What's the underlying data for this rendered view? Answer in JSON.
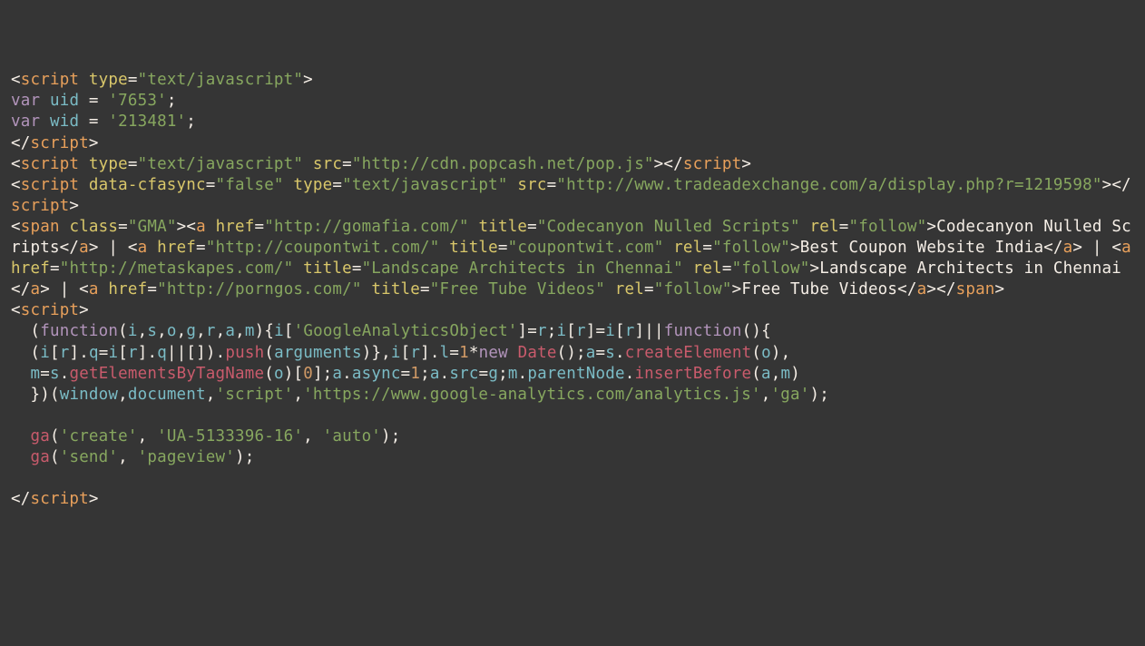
{
  "tokens": [
    {
      "c": "white",
      "t": "<"
    },
    {
      "c": "tag",
      "t": "script"
    },
    {
      "c": "white",
      "t": " "
    },
    {
      "c": "attr",
      "t": "type"
    },
    {
      "c": "white",
      "t": "="
    },
    {
      "c": "str",
      "t": "\"text/javascript\""
    },
    {
      "c": "white",
      "t": ">\n"
    },
    {
      "c": "kw",
      "t": "var"
    },
    {
      "c": "white",
      "t": " "
    },
    {
      "c": "cyan",
      "t": "uid"
    },
    {
      "c": "white",
      "t": " = "
    },
    {
      "c": "str",
      "t": "'7653'"
    },
    {
      "c": "white",
      "t": ";\n"
    },
    {
      "c": "kw",
      "t": "var"
    },
    {
      "c": "white",
      "t": " "
    },
    {
      "c": "cyan",
      "t": "wid"
    },
    {
      "c": "white",
      "t": " = "
    },
    {
      "c": "str",
      "t": "'213481'"
    },
    {
      "c": "white",
      "t": ";\n"
    },
    {
      "c": "white",
      "t": "</"
    },
    {
      "c": "tag",
      "t": "script"
    },
    {
      "c": "white",
      "t": ">\n"
    },
    {
      "c": "white",
      "t": "<"
    },
    {
      "c": "tag",
      "t": "script"
    },
    {
      "c": "white",
      "t": " "
    },
    {
      "c": "attr",
      "t": "type"
    },
    {
      "c": "white",
      "t": "="
    },
    {
      "c": "str",
      "t": "\"text/javascript\""
    },
    {
      "c": "white",
      "t": " "
    },
    {
      "c": "attr",
      "t": "src"
    },
    {
      "c": "white",
      "t": "="
    },
    {
      "c": "str",
      "t": "\"http://cdn.popcash.net/pop.js\""
    },
    {
      "c": "white",
      "t": "></"
    },
    {
      "c": "tag",
      "t": "script"
    },
    {
      "c": "white",
      "t": ">\n"
    },
    {
      "c": "white",
      "t": "<"
    },
    {
      "c": "tag",
      "t": "script"
    },
    {
      "c": "white",
      "t": " "
    },
    {
      "c": "attr",
      "t": "data-cfasync"
    },
    {
      "c": "white",
      "t": "="
    },
    {
      "c": "str",
      "t": "\"false\""
    },
    {
      "c": "white",
      "t": " "
    },
    {
      "c": "attr",
      "t": "type"
    },
    {
      "c": "white",
      "t": "="
    },
    {
      "c": "str",
      "t": "\"text/javascript\""
    },
    {
      "c": "white",
      "t": " "
    },
    {
      "c": "attr",
      "t": "src"
    },
    {
      "c": "white",
      "t": "="
    },
    {
      "c": "str",
      "t": "\"http://www.tradeadexchange.com/a/display.php?r=1219598\""
    },
    {
      "c": "white",
      "t": "></"
    },
    {
      "c": "tag",
      "t": "script"
    },
    {
      "c": "white",
      "t": ">\n"
    },
    {
      "c": "white",
      "t": "<"
    },
    {
      "c": "tag",
      "t": "span"
    },
    {
      "c": "white",
      "t": " "
    },
    {
      "c": "attr",
      "t": "class"
    },
    {
      "c": "white",
      "t": "="
    },
    {
      "c": "str",
      "t": "\"GMA\""
    },
    {
      "c": "white",
      "t": "><"
    },
    {
      "c": "tag",
      "t": "a"
    },
    {
      "c": "white",
      "t": " "
    },
    {
      "c": "attr",
      "t": "href"
    },
    {
      "c": "white",
      "t": "="
    },
    {
      "c": "str",
      "t": "\"http://gomafia.com/\""
    },
    {
      "c": "white",
      "t": " "
    },
    {
      "c": "attr",
      "t": "title"
    },
    {
      "c": "white",
      "t": "="
    },
    {
      "c": "str",
      "t": "\"Codecanyon Nulled Scripts\""
    },
    {
      "c": "white",
      "t": " "
    },
    {
      "c": "attr",
      "t": "rel"
    },
    {
      "c": "white",
      "t": "="
    },
    {
      "c": "str",
      "t": "\"follow\""
    },
    {
      "c": "white",
      "t": ">Codecanyon Nulled Scripts</"
    },
    {
      "c": "tag",
      "t": "a"
    },
    {
      "c": "white",
      "t": "> | <"
    },
    {
      "c": "tag",
      "t": "a"
    },
    {
      "c": "white",
      "t": " "
    },
    {
      "c": "attr",
      "t": "href"
    },
    {
      "c": "white",
      "t": "="
    },
    {
      "c": "str",
      "t": "\"http://coupontwit.com/\""
    },
    {
      "c": "white",
      "t": " "
    },
    {
      "c": "attr",
      "t": "title"
    },
    {
      "c": "white",
      "t": "="
    },
    {
      "c": "str",
      "t": "\"coupontwit.com\""
    },
    {
      "c": "white",
      "t": " "
    },
    {
      "c": "attr",
      "t": "rel"
    },
    {
      "c": "white",
      "t": "="
    },
    {
      "c": "str",
      "t": "\"follow\""
    },
    {
      "c": "white",
      "t": ">Best Coupon Website India</"
    },
    {
      "c": "tag",
      "t": "a"
    },
    {
      "c": "white",
      "t": "> | <"
    },
    {
      "c": "tag",
      "t": "a"
    },
    {
      "c": "white",
      "t": " "
    },
    {
      "c": "attr",
      "t": "href"
    },
    {
      "c": "white",
      "t": "="
    },
    {
      "c": "str",
      "t": "\"http://metaskapes.com/\""
    },
    {
      "c": "white",
      "t": " "
    },
    {
      "c": "attr",
      "t": "title"
    },
    {
      "c": "white",
      "t": "="
    },
    {
      "c": "str",
      "t": "\"Landscape Architects in Chennai\""
    },
    {
      "c": "white",
      "t": " "
    },
    {
      "c": "attr",
      "t": "rel"
    },
    {
      "c": "white",
      "t": "="
    },
    {
      "c": "str",
      "t": "\"follow\""
    },
    {
      "c": "white",
      "t": ">Landscape Architects in Chennai</"
    },
    {
      "c": "tag",
      "t": "a"
    },
    {
      "c": "white",
      "t": "> | <"
    },
    {
      "c": "tag",
      "t": "a"
    },
    {
      "c": "white",
      "t": " "
    },
    {
      "c": "attr",
      "t": "href"
    },
    {
      "c": "white",
      "t": "="
    },
    {
      "c": "str",
      "t": "\"http://porngos.com/\""
    },
    {
      "c": "white",
      "t": " "
    },
    {
      "c": "attr",
      "t": "title"
    },
    {
      "c": "white",
      "t": "="
    },
    {
      "c": "str",
      "t": "\"Free Tube Videos\""
    },
    {
      "c": "white",
      "t": " "
    },
    {
      "c": "attr",
      "t": "rel"
    },
    {
      "c": "white",
      "t": "="
    },
    {
      "c": "str",
      "t": "\"follow\""
    },
    {
      "c": "white",
      "t": ">Free Tube Videos</"
    },
    {
      "c": "tag",
      "t": "a"
    },
    {
      "c": "white",
      "t": "></"
    },
    {
      "c": "tag",
      "t": "span"
    },
    {
      "c": "white",
      "t": ">\n"
    },
    {
      "c": "white",
      "t": "<"
    },
    {
      "c": "tag",
      "t": "script"
    },
    {
      "c": "white",
      "t": ">\n"
    },
    {
      "c": "white",
      "t": "  ("
    },
    {
      "c": "kw",
      "t": "function"
    },
    {
      "c": "white",
      "t": "("
    },
    {
      "c": "cyan",
      "t": "i"
    },
    {
      "c": "white",
      "t": ","
    },
    {
      "c": "cyan",
      "t": "s"
    },
    {
      "c": "white",
      "t": ","
    },
    {
      "c": "cyan",
      "t": "o"
    },
    {
      "c": "white",
      "t": ","
    },
    {
      "c": "cyan",
      "t": "g"
    },
    {
      "c": "white",
      "t": ","
    },
    {
      "c": "cyan",
      "t": "r"
    },
    {
      "c": "white",
      "t": ","
    },
    {
      "c": "cyan",
      "t": "a"
    },
    {
      "c": "white",
      "t": ","
    },
    {
      "c": "cyan",
      "t": "m"
    },
    {
      "c": "white",
      "t": "){"
    },
    {
      "c": "cyan",
      "t": "i"
    },
    {
      "c": "white",
      "t": "["
    },
    {
      "c": "str",
      "t": "'GoogleAnalyticsObject'"
    },
    {
      "c": "white",
      "t": "]="
    },
    {
      "c": "cyan",
      "t": "r"
    },
    {
      "c": "white",
      "t": ";"
    },
    {
      "c": "cyan",
      "t": "i"
    },
    {
      "c": "white",
      "t": "["
    },
    {
      "c": "cyan",
      "t": "r"
    },
    {
      "c": "white",
      "t": "]="
    },
    {
      "c": "cyan",
      "t": "i"
    },
    {
      "c": "white",
      "t": "["
    },
    {
      "c": "cyan",
      "t": "r"
    },
    {
      "c": "white",
      "t": "]||"
    },
    {
      "c": "kw",
      "t": "function"
    },
    {
      "c": "white",
      "t": "(){\n"
    },
    {
      "c": "white",
      "t": "  ("
    },
    {
      "c": "cyan",
      "t": "i"
    },
    {
      "c": "white",
      "t": "["
    },
    {
      "c": "cyan",
      "t": "r"
    },
    {
      "c": "white",
      "t": "]."
    },
    {
      "c": "cyan",
      "t": "q"
    },
    {
      "c": "white",
      "t": "="
    },
    {
      "c": "cyan",
      "t": "i"
    },
    {
      "c": "white",
      "t": "["
    },
    {
      "c": "cyan",
      "t": "r"
    },
    {
      "c": "white",
      "t": "]."
    },
    {
      "c": "cyan",
      "t": "q"
    },
    {
      "c": "white",
      "t": "||[])."
    },
    {
      "c": "mag",
      "t": "push"
    },
    {
      "c": "white",
      "t": "("
    },
    {
      "c": "cyan",
      "t": "arguments"
    },
    {
      "c": "white",
      "t": ")},"
    },
    {
      "c": "cyan",
      "t": "i"
    },
    {
      "c": "white",
      "t": "["
    },
    {
      "c": "cyan",
      "t": "r"
    },
    {
      "c": "white",
      "t": "]."
    },
    {
      "c": "cyan",
      "t": "l"
    },
    {
      "c": "white",
      "t": "="
    },
    {
      "c": "num",
      "t": "1"
    },
    {
      "c": "white",
      "t": "*"
    },
    {
      "c": "kw",
      "t": "new"
    },
    {
      "c": "white",
      "t": " "
    },
    {
      "c": "mag",
      "t": "Date"
    },
    {
      "c": "white",
      "t": "();"
    },
    {
      "c": "cyan",
      "t": "a"
    },
    {
      "c": "white",
      "t": "="
    },
    {
      "c": "cyan",
      "t": "s"
    },
    {
      "c": "white",
      "t": "."
    },
    {
      "c": "mag",
      "t": "createElement"
    },
    {
      "c": "white",
      "t": "("
    },
    {
      "c": "cyan",
      "t": "o"
    },
    {
      "c": "white",
      "t": "),\n"
    },
    {
      "c": "white",
      "t": "  "
    },
    {
      "c": "cyan",
      "t": "m"
    },
    {
      "c": "white",
      "t": "="
    },
    {
      "c": "cyan",
      "t": "s"
    },
    {
      "c": "white",
      "t": "."
    },
    {
      "c": "mag",
      "t": "getElementsByTagName"
    },
    {
      "c": "white",
      "t": "("
    },
    {
      "c": "cyan",
      "t": "o"
    },
    {
      "c": "white",
      "t": ")["
    },
    {
      "c": "num",
      "t": "0"
    },
    {
      "c": "white",
      "t": "];"
    },
    {
      "c": "cyan",
      "t": "a"
    },
    {
      "c": "white",
      "t": "."
    },
    {
      "c": "cyan",
      "t": "async"
    },
    {
      "c": "white",
      "t": "="
    },
    {
      "c": "num",
      "t": "1"
    },
    {
      "c": "white",
      "t": ";"
    },
    {
      "c": "cyan",
      "t": "a"
    },
    {
      "c": "white",
      "t": "."
    },
    {
      "c": "cyan",
      "t": "src"
    },
    {
      "c": "white",
      "t": "="
    },
    {
      "c": "cyan",
      "t": "g"
    },
    {
      "c": "white",
      "t": ";"
    },
    {
      "c": "cyan",
      "t": "m"
    },
    {
      "c": "white",
      "t": "."
    },
    {
      "c": "cyan",
      "t": "parentNode"
    },
    {
      "c": "white",
      "t": "."
    },
    {
      "c": "mag",
      "t": "insertBefore"
    },
    {
      "c": "white",
      "t": "("
    },
    {
      "c": "cyan",
      "t": "a"
    },
    {
      "c": "white",
      "t": ","
    },
    {
      "c": "cyan",
      "t": "m"
    },
    {
      "c": "white",
      "t": ")\n"
    },
    {
      "c": "white",
      "t": "  })("
    },
    {
      "c": "cyan",
      "t": "window"
    },
    {
      "c": "white",
      "t": ","
    },
    {
      "c": "cyan",
      "t": "document"
    },
    {
      "c": "white",
      "t": ","
    },
    {
      "c": "str",
      "t": "'script'"
    },
    {
      "c": "white",
      "t": ","
    },
    {
      "c": "str",
      "t": "'https://www.google-analytics.com/analytics.js'"
    },
    {
      "c": "white",
      "t": ","
    },
    {
      "c": "str",
      "t": "'ga'"
    },
    {
      "c": "white",
      "t": ");\n"
    },
    {
      "c": "white",
      "t": "\n"
    },
    {
      "c": "white",
      "t": "  "
    },
    {
      "c": "mag",
      "t": "ga"
    },
    {
      "c": "white",
      "t": "("
    },
    {
      "c": "str",
      "t": "'create'"
    },
    {
      "c": "white",
      "t": ", "
    },
    {
      "c": "str",
      "t": "'UA-5133396-16'"
    },
    {
      "c": "white",
      "t": ", "
    },
    {
      "c": "str",
      "t": "'auto'"
    },
    {
      "c": "white",
      "t": ");\n"
    },
    {
      "c": "white",
      "t": "  "
    },
    {
      "c": "mag",
      "t": "ga"
    },
    {
      "c": "white",
      "t": "("
    },
    {
      "c": "str",
      "t": "'send'"
    },
    {
      "c": "white",
      "t": ", "
    },
    {
      "c": "str",
      "t": "'pageview'"
    },
    {
      "c": "white",
      "t": ");\n"
    },
    {
      "c": "white",
      "t": "\n"
    },
    {
      "c": "white",
      "t": "</"
    },
    {
      "c": "tag",
      "t": "script"
    },
    {
      "c": "white",
      "t": ">"
    }
  ]
}
